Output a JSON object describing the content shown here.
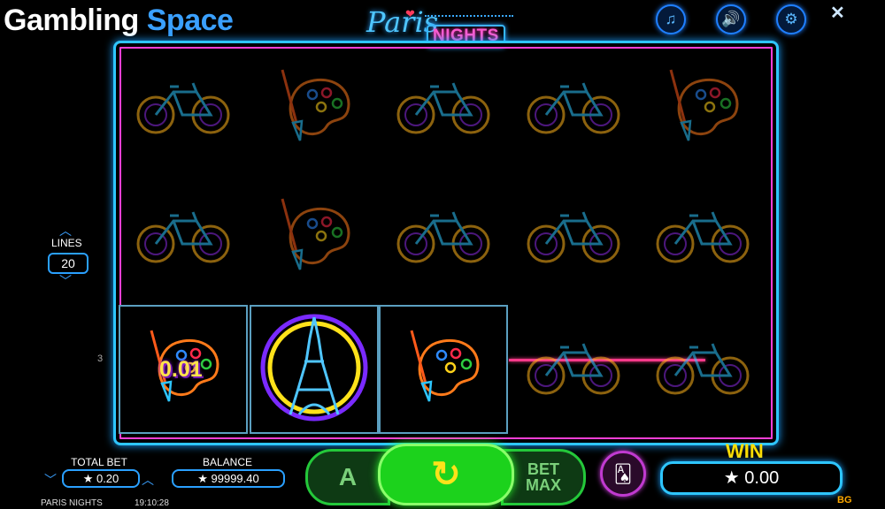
{
  "watermark": {
    "part1": "Gambling",
    "part2": "Space"
  },
  "logo": {
    "paris": "Paris",
    "nights": "NIGHTS"
  },
  "header_buttons": [
    {
      "name": "music-icon",
      "glyph": "♫"
    },
    {
      "name": "sound-icon",
      "glyph": "🔊"
    },
    {
      "name": "settings-icon",
      "glyph": "⚙"
    }
  ],
  "close_glyph": "✕",
  "reels": {
    "rows": [
      [
        "bicycle",
        "palette",
        "bicycle",
        "bicycle",
        "palette"
      ],
      [
        "bicycle",
        "palette",
        "bicycle",
        "bicycle",
        "bicycle"
      ],
      [
        "palette",
        "eiffel-tower",
        "palette",
        "bicycle",
        "bicycle"
      ]
    ],
    "winning_cells": [
      [
        2,
        0
      ],
      [
        2,
        1
      ],
      [
        2,
        2
      ]
    ],
    "payline_number": "3",
    "win_amount_label": "0.01"
  },
  "lines": {
    "label": "LINES",
    "value": "20"
  },
  "total_bet": {
    "label": "TOTAL BET",
    "value": "★ 0.20"
  },
  "balance": {
    "label": "BALANCE",
    "value": "★ 99999.40"
  },
  "buttons": {
    "autoplay": "A",
    "spin_glyph": "↻",
    "bet_max_line1": "BET",
    "bet_max_line2": "MAX"
  },
  "win": {
    "label": "WIN",
    "value": "★ 0.00"
  },
  "footer": {
    "game_name": "PARIS NIGHTS",
    "time": "19:10:28",
    "provider_badge": "BG"
  },
  "colors": {
    "neon_blue": "#2ec6ff",
    "neon_pink": "#ff3fd6",
    "spin_green": "#1cd21c",
    "win_yellow": "#ffdd00"
  }
}
